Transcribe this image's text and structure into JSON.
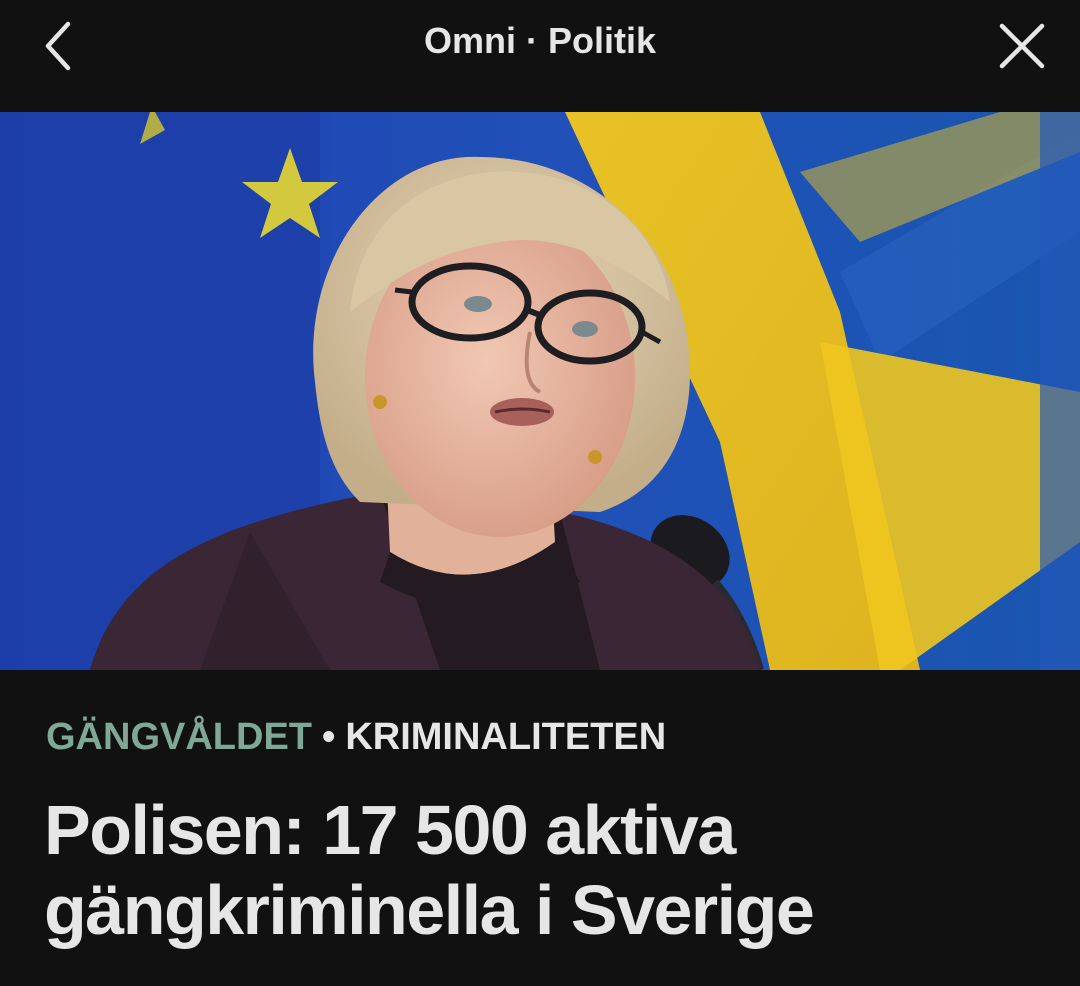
{
  "header": {
    "title": "Omni · Politik",
    "back_icon": "chevron-left-icon",
    "close_icon": "close-icon"
  },
  "article": {
    "image_icon": "article-photo",
    "tags": {
      "primary": "GÄNGVÅLDET",
      "separator": "•",
      "secondary": "KRIMINALITETEN"
    },
    "headline": "Polisen: 17 500 aktiva gängkriminella i Sverige"
  },
  "colors": {
    "background": "#111111",
    "text": "#e6e6e6",
    "tag_accent": "#7fa897"
  }
}
